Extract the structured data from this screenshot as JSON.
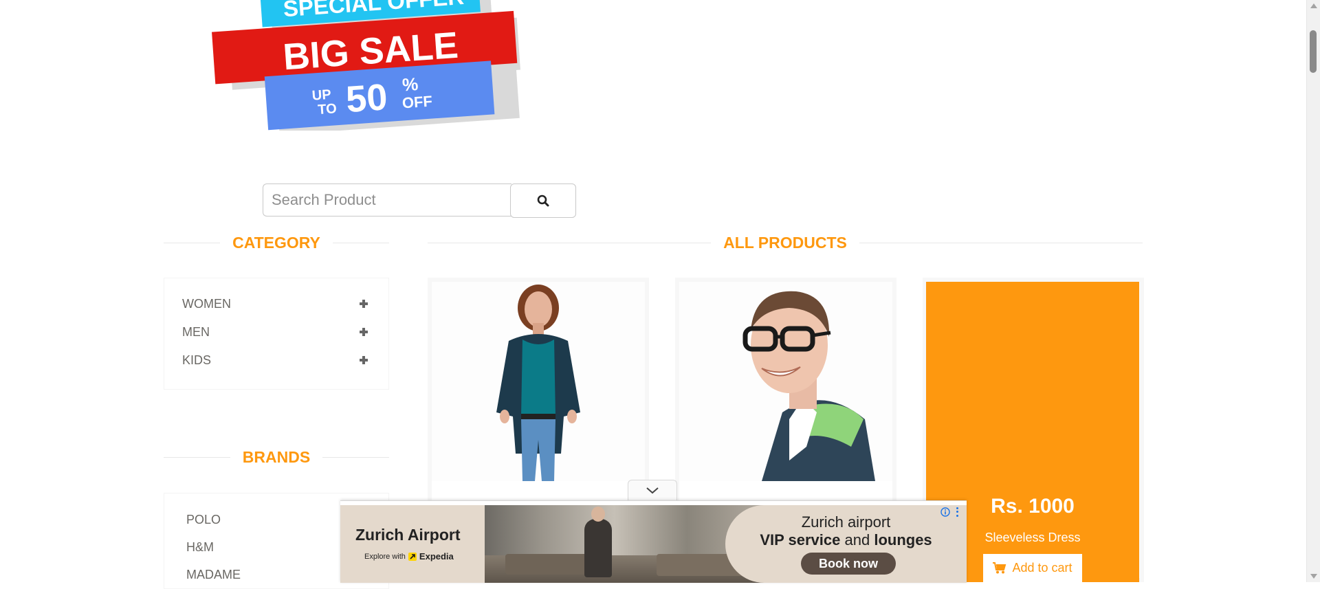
{
  "banner": {
    "line1": "SPECIAL OFFER",
    "line2": "BIG SALE",
    "line3_up": "UP",
    "line3_to": "TO",
    "line3_num": "50",
    "line3_pct": "%",
    "line3_off": "OFF",
    "colors": {
      "cyan": "#22c4f2",
      "red": "#e11a14",
      "blue": "#5b8bf0",
      "shadow": "#d9d9d9"
    }
  },
  "search": {
    "placeholder": "Search Product",
    "button_icon": "search-icon"
  },
  "category": {
    "heading": "CATEGORY",
    "items": [
      {
        "label": "WOMEN",
        "icon": "plus-icon"
      },
      {
        "label": "MEN",
        "icon": "plus-icon"
      },
      {
        "label": "KIDS",
        "icon": "plus-icon"
      }
    ]
  },
  "brands": {
    "heading": "BRANDS",
    "items": [
      {
        "label": "POLO"
      },
      {
        "label": "H&M"
      },
      {
        "label": "MADAME"
      }
    ]
  },
  "products": {
    "heading": "ALL PRODUCTS",
    "items": [
      {
        "image": "woman-in-jacket-photo"
      },
      {
        "image": "man-with-glasses-photo"
      },
      {
        "price": "Rs. 1000",
        "name": "Sleeveless Dress",
        "cart_label": "Add to cart",
        "cart_icon": "shopping-cart-icon"
      }
    ]
  },
  "ad": {
    "brand": "Zurich Airport",
    "sub_prefix": "Explore with",
    "sub_brand": "Expedia",
    "headline1": "Zurich airport",
    "headline2_bold1": "VIP service",
    "headline2_mid": "and",
    "headline2_bold2": "lounges",
    "cta": "Book now",
    "toggle_icon": "chevron-down-icon",
    "info_icon": "info-icon",
    "menu_icon": "more-vertical-icon"
  },
  "colors": {
    "accent": "#FE980F",
    "text": "#696763"
  }
}
